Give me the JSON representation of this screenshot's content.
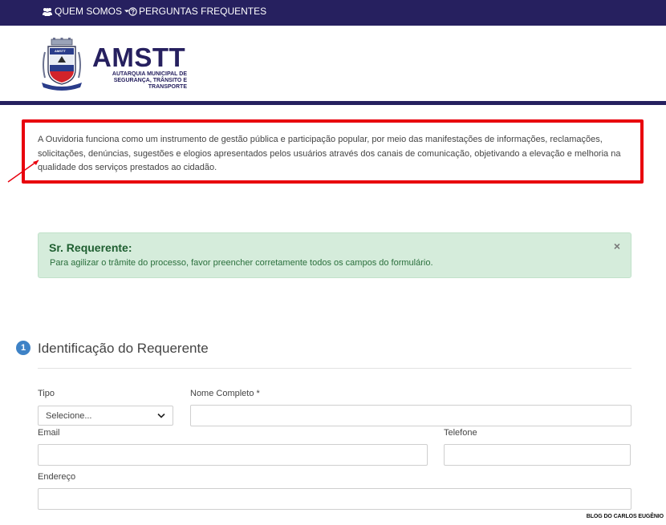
{
  "nav": {
    "about_label": "QUEM SOMOS",
    "faq_label": "PERGUNTAS FREQUENTES",
    "about_icon": "users-icon",
    "faq_icon": "question-circle-icon"
  },
  "brand": {
    "title": "AMSTT",
    "subtitle_line1": "AUTARQUIA MUNICIPAL DE",
    "subtitle_line2": "SEGURANÇA, TRÂNSITO E TRANSPORTE",
    "logo_label": "AMSTT",
    "primary_color": "#26205f"
  },
  "info": {
    "text": "A Ouvidoria funciona como um instrumento de gestão pública e participação popular, por meio das manifestações de informações, reclamações, solicitações, denúncias, sugestões e elogios apresentados pelos usuários através dos canais de comunicação, objetivando a elevação e melhoria na qualidade dos serviços prestados ao cidadão.",
    "highlight_color": "#e8000d"
  },
  "alert": {
    "title": "Sr. Requerente:",
    "message": "Para agilizar o trâmite do processo, favor preencher corretamente todos os campos do formulário.",
    "close_label": "×"
  },
  "section": {
    "step": "1",
    "title": "Identificação do Requerente"
  },
  "form": {
    "tipo_label": "Tipo",
    "tipo_selected": "Selecione...",
    "nome_label": "Nome Completo *",
    "email_label": "Email",
    "telefone_label": "Telefone",
    "endereco_label": "Endereço"
  },
  "watermark": "BLOG DO CARLOS EUGÊNIO"
}
